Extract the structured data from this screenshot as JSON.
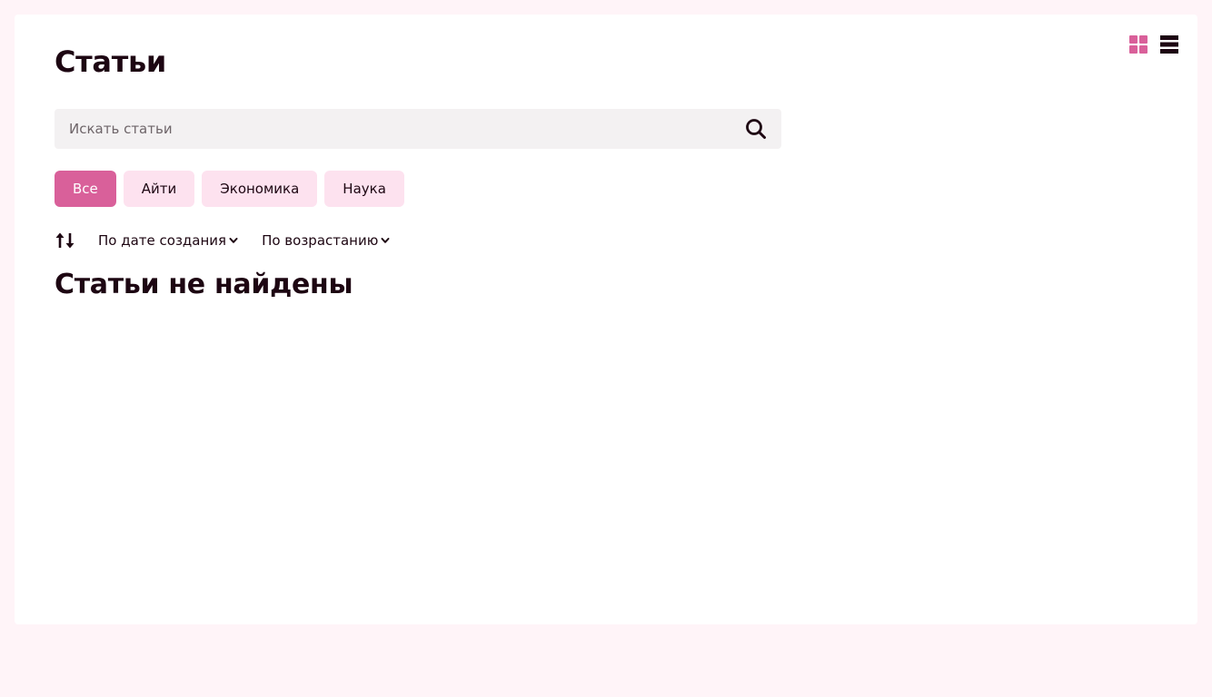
{
  "header": {
    "title": "Статьи"
  },
  "view_toggle": {
    "grid_icon": "grid-icon",
    "list_icon": "list-icon",
    "active": "grid"
  },
  "search": {
    "value": "",
    "placeholder": "Искать статьи",
    "icon": "search-icon"
  },
  "tags": [
    {
      "label": "Все",
      "active": true
    },
    {
      "label": "Айти",
      "active": false
    },
    {
      "label": "Экономика",
      "active": false
    },
    {
      "label": "Наука",
      "active": false
    }
  ],
  "sort": {
    "icon": "sort-icon",
    "field": "По дате создания",
    "order": "По возрастанию",
    "chevron_icon": "chevron-down-icon"
  },
  "results": {
    "empty_message": "Статьи не найдены"
  },
  "colors": {
    "accent": "#d9609a",
    "tag_background": "#fde2ef",
    "page_background": "#fff4f8",
    "text": "#1d0612",
    "search_background": "#f3f1f2"
  }
}
